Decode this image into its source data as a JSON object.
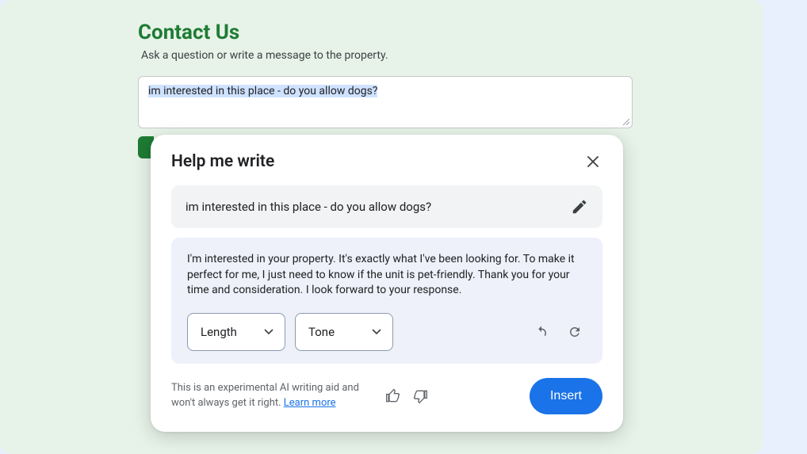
{
  "page": {
    "title": "Contact Us",
    "subtitle": "Ask a question or write a message to the property.",
    "message_value": "im interested in this place - do you allow dogs?"
  },
  "popup": {
    "title": "Help me write",
    "prompt_text": "im interested in this place - do you allow dogs?",
    "result_text": "I'm interested in your property. It's exactly what I've been looking for. To make it perfect for me, I just need to know if the unit is pet-friendly. Thank you for your time and consideration. I look forward to your response.",
    "length_label": "Length",
    "tone_label": "Tone",
    "disclaimer_prefix": "This is an experimental AI writing aid and won't always get it right. ",
    "learn_more_label": "Learn more",
    "insert_label": "Insert"
  }
}
